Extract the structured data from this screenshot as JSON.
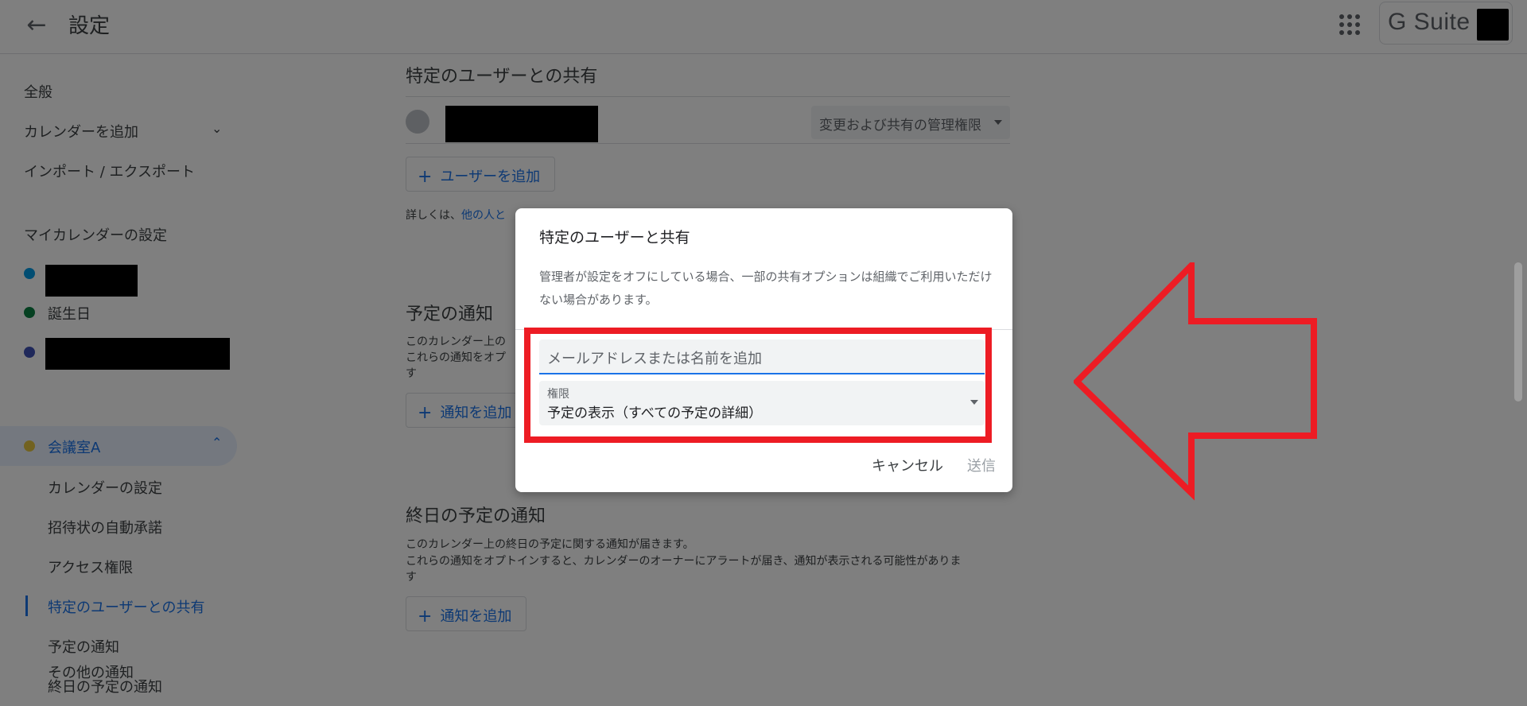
{
  "header": {
    "title": "設定",
    "brand": "G Suite"
  },
  "sidebar": {
    "items": [
      {
        "label": "全般"
      },
      {
        "label": "カレンダーを追加"
      },
      {
        "label": "インポート / エクスポート"
      }
    ],
    "my_calendars_heading": "マイカレンダーの設定",
    "calendars": [
      {
        "label": "",
        "color": "#039be5",
        "redacted": true
      },
      {
        "label": "誕生日",
        "color": "#0b8043"
      },
      {
        "label": "",
        "color": "#3f51b5",
        "redacted": true
      },
      {
        "label": "会議室A",
        "color": "#e4c441",
        "active": true
      }
    ],
    "sub_items": [
      {
        "label": "カレンダーの設定"
      },
      {
        "label": "招待状の自動承諾"
      },
      {
        "label": "アクセス権限"
      },
      {
        "label": "特定のユーザーとの共有",
        "selected": true
      },
      {
        "label": "予定の通知"
      },
      {
        "label": "終日の予定の通知"
      },
      {
        "label": "その他の通知"
      }
    ]
  },
  "main": {
    "share_section": {
      "title": "特定のユーザーとの共有",
      "permission_select": "変更および共有の管理権限",
      "add_user_button": "ユーザーを追加",
      "help_prefix": "詳しくは、",
      "help_link": "他の人と"
    },
    "event_notifications": {
      "title": "予定の通知",
      "desc_line1": "このカレンダー上の",
      "desc_line2": "これらの通知をオプ",
      "desc_line3": "す",
      "add_button": "通知を追加"
    },
    "allday_notifications": {
      "title": "終日の予定の通知",
      "desc_line1": "このカレンダー上の終日の予定に関する通知が届きます。",
      "desc_line2": "これらの通知をオプトインすると、カレンダーのオーナーにアラートが届き、通知が表示される可能性がありま",
      "desc_line3": "す",
      "add_button": "通知を追加"
    }
  },
  "dialog": {
    "title": "特定のユーザーと共有",
    "note": "管理者が設定をオフにしている場合、一部の共有オプションは組織でご利用いただけない場合があります。",
    "email_placeholder": "メールアドレスまたは名前を追加",
    "permission_label": "権限",
    "permission_value": "予定の表示（すべての予定の詳細）",
    "cancel": "キャンセル",
    "send": "送信"
  },
  "annotation": {
    "color": "#ed1c24",
    "arrow_direction": "left"
  }
}
